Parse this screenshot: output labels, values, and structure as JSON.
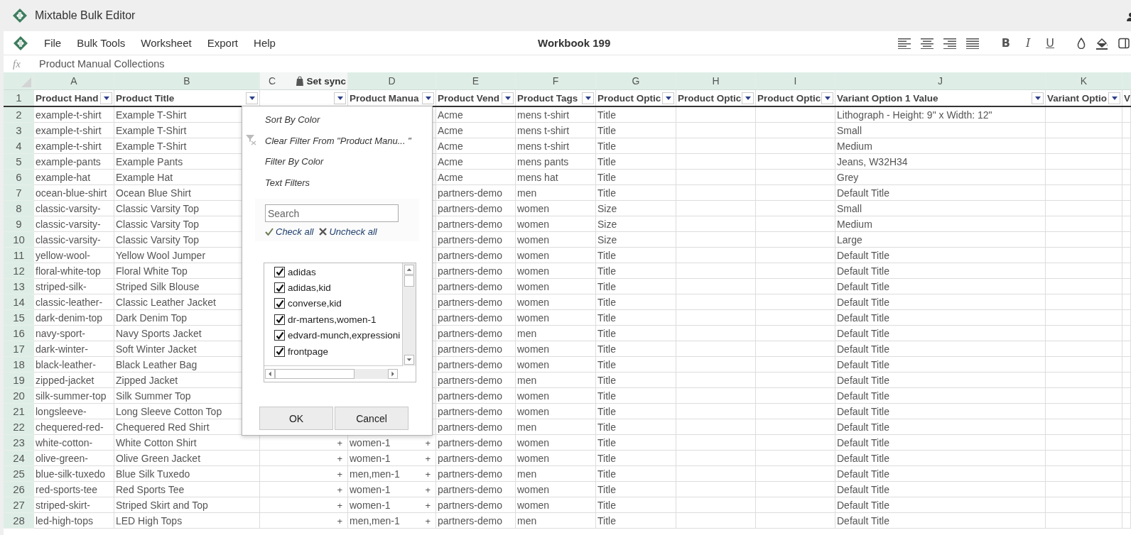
{
  "app": {
    "title": "Mixtable Bulk Editor"
  },
  "menu": [
    "File",
    "Bulk Tools",
    "Worksheet",
    "Export",
    "Help"
  ],
  "workbook_title": "Workbook 199",
  "format_buttons": [
    "B",
    "I",
    "U"
  ],
  "formula_bar": {
    "label": "fx",
    "value": "Product Manual Collections"
  },
  "columns": [
    {
      "letter": "A",
      "header": "Product Hand",
      "filter": true
    },
    {
      "letter": "B",
      "header": "Product Title",
      "filter": true
    },
    {
      "letter": "C",
      "sync": "Set sync",
      "filter": true
    },
    {
      "letter": "D",
      "header": "Product Manua",
      "filter": true
    },
    {
      "letter": "E",
      "header": "Product Vend",
      "filter": true
    },
    {
      "letter": "F",
      "header": "Product Tags",
      "filter": true
    },
    {
      "letter": "G",
      "header": "Product Optic",
      "filter": true
    },
    {
      "letter": "H",
      "header": "Product Optic",
      "filter": true
    },
    {
      "letter": "I",
      "header": "Product Optic",
      "filter": true
    },
    {
      "letter": "J",
      "header": "Variant Option 1 Value",
      "filter": true
    },
    {
      "letter": "K",
      "header": "Variant Optio",
      "filter": true
    },
    {
      "header": "V",
      "filter": false
    }
  ],
  "header_row_number": "1",
  "rows": [
    {
      "number": "2",
      "a": "example-t-shirt",
      "b": "Example T-Shirt",
      "e": "Acme",
      "f": "mens t-shirt",
      "g": "Title",
      "j": "Lithograph - Height: 9\" x Width: 12\""
    },
    {
      "number": "3",
      "a": "example-t-shirt",
      "b": "Example T-Shirt",
      "e": "Acme",
      "f": "mens t-shirt",
      "g": "Title",
      "j": "Small"
    },
    {
      "number": "4",
      "a": "example-t-shirt",
      "b": "Example T-Shirt",
      "e": "Acme",
      "f": "mens t-shirt",
      "g": "Title",
      "j": "Medium"
    },
    {
      "number": "5",
      "a": "example-pants",
      "b": "Example Pants",
      "e": "Acme",
      "f": "mens pants",
      "g": "Title",
      "j": "Jeans, W32H34"
    },
    {
      "number": "6",
      "a": "example-hat",
      "b": "Example Hat",
      "e": "Acme",
      "f": "mens hat",
      "g": "Title",
      "j": "Grey"
    },
    {
      "number": "7",
      "a": "ocean-blue-shirt",
      "b": "Ocean Blue Shirt",
      "e": "partners-demo",
      "f": "men",
      "g": "Title",
      "j": "Default Title"
    },
    {
      "number": "8",
      "a": "classic-varsity-",
      "b": "Classic Varsity Top",
      "e": "partners-demo",
      "f": "women",
      "g": "Size",
      "j": "Small"
    },
    {
      "number": "9",
      "a": "classic-varsity-",
      "b": "Classic Varsity Top",
      "e": "partners-demo",
      "f": "women",
      "g": "Size",
      "j": "Medium"
    },
    {
      "number": "10",
      "a": "classic-varsity-",
      "b": "Classic Varsity Top",
      "e": "partners-demo",
      "f": "women",
      "g": "Size",
      "j": "Large"
    },
    {
      "number": "11",
      "a": "yellow-wool-",
      "b": "Yellow Wool Jumper",
      "e": "partners-demo",
      "f": "women",
      "g": "Title",
      "j": "Default Title"
    },
    {
      "number": "12",
      "a": "floral-white-top",
      "b": "Floral White Top",
      "e": "partners-demo",
      "f": "women",
      "g": "Title",
      "j": "Default Title"
    },
    {
      "number": "13",
      "a": "striped-silk-",
      "b": "Striped Silk Blouse",
      "e": "partners-demo",
      "f": "women",
      "g": "Title",
      "j": "Default Title"
    },
    {
      "number": "14",
      "a": "classic-leather-",
      "b": "Classic Leather Jacket",
      "e": "partners-demo",
      "f": "women",
      "g": "Title",
      "j": "Default Title"
    },
    {
      "number": "15",
      "a": "dark-denim-top",
      "b": "Dark Denim Top",
      "e": "partners-demo",
      "f": "women",
      "g": "Title",
      "j": "Default Title"
    },
    {
      "number": "16",
      "a": "navy-sport-",
      "b": "Navy Sports Jacket",
      "e": "partners-demo",
      "f": "men",
      "g": "Title",
      "j": "Default Title"
    },
    {
      "number": "17",
      "a": "dark-winter-",
      "b": "Soft Winter Jacket",
      "e": "partners-demo",
      "f": "women",
      "g": "Title",
      "j": "Default Title"
    },
    {
      "number": "18",
      "a": "black-leather-",
      "b": "Black Leather Bag",
      "e": "partners-demo",
      "f": "women",
      "g": "Title",
      "j": "Default Title"
    },
    {
      "number": "19",
      "a": "zipped-jacket",
      "b": "Zipped Jacket",
      "e": "partners-demo",
      "f": "men",
      "g": "Title",
      "j": "Default Title"
    },
    {
      "number": "20",
      "a": "silk-summer-top",
      "b": "Silk Summer Top",
      "e": "partners-demo",
      "f": "women",
      "g": "Title",
      "j": "Default Title"
    },
    {
      "number": "21",
      "a": "longsleeve-",
      "b": "Long Sleeve Cotton Top",
      "e": "partners-demo",
      "f": "women",
      "g": "Title",
      "j": "Default Title"
    },
    {
      "number": "22",
      "a": "chequered-red-",
      "b": "Chequered Red Shirt",
      "e": "partners-demo",
      "f": "men",
      "g": "Title",
      "j": "Default Title"
    },
    {
      "number": "23",
      "a": "white-cotton-",
      "b": "White Cotton Shirt",
      "c": "+",
      "d": "women-1",
      "d_plus": "+",
      "e": "partners-demo",
      "f": "women",
      "g": "Title",
      "j": "Default Title"
    },
    {
      "number": "24",
      "a": "olive-green-",
      "b": "Olive Green Jacket",
      "c": "+",
      "d": "women-1",
      "d_plus": "+",
      "e": "partners-demo",
      "f": "women",
      "g": "Title",
      "j": "Default Title"
    },
    {
      "number": "25",
      "a": "blue-silk-tuxedo",
      "b": "Blue Silk Tuxedo",
      "c": "+",
      "d": "men,men-1",
      "d_plus": "+",
      "e": "partners-demo",
      "f": "men",
      "g": "Title",
      "j": "Default Title"
    },
    {
      "number": "26",
      "a": "red-sports-tee",
      "b": "Red Sports Tee",
      "c": "+",
      "d": "women-1",
      "d_plus": "+",
      "e": "partners-demo",
      "f": "women",
      "g": "Title",
      "j": "Default Title"
    },
    {
      "number": "27",
      "a": "striped-skirt-",
      "b": "Striped Skirt and Top",
      "c": "+",
      "d": "women-1",
      "d_plus": "+",
      "e": "partners-demo",
      "f": "women",
      "g": "Title",
      "j": "Default Title"
    },
    {
      "number": "28",
      "a": "led-high-tops",
      "b": "LED High Tops",
      "c": "+",
      "d": "men,men-1",
      "d_plus": "+",
      "e": "partners-demo",
      "f": "men",
      "g": "Title",
      "j": "Default Title"
    }
  ],
  "filter_popup": {
    "menu": [
      {
        "label": "Sort By Color",
        "kind": "plain"
      },
      {
        "label": "Clear Filter From \"Product Manu... \"",
        "kind": "clear"
      },
      {
        "label": "Filter By Color",
        "kind": "plain"
      },
      {
        "label": "Text Filters",
        "kind": "plain"
      }
    ],
    "search": {
      "placeholder": "Search"
    },
    "check_all": "Check all",
    "uncheck_all": "Uncheck all",
    "values": [
      {
        "label": "adidas",
        "checked": true
      },
      {
        "label": "adidas,kid",
        "checked": true
      },
      {
        "label": "converse,kid",
        "checked": true
      },
      {
        "label": "dr-martens,women-1",
        "checked": true
      },
      {
        "label": "edvard-munch,expressioni",
        "checked": true
      },
      {
        "label": "frontpage",
        "checked": true
      }
    ],
    "buttons": [
      "OK",
      "Cancel"
    ]
  }
}
